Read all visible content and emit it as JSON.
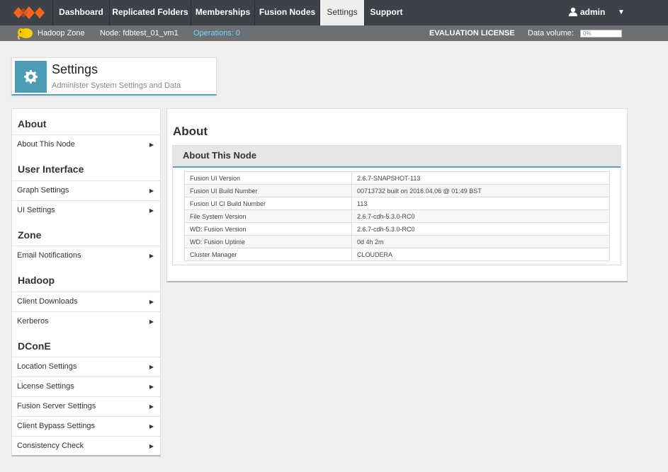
{
  "nav": {
    "tabs": [
      {
        "label": "Dashboard",
        "active": false
      },
      {
        "label": "Replicated Folders",
        "active": false
      },
      {
        "label": "Memberships",
        "active": false
      },
      {
        "label": "Fusion Nodes",
        "active": false
      },
      {
        "label": "Settings",
        "active": true
      },
      {
        "label": "Support",
        "active": false
      }
    ],
    "user": "admin",
    "user_caret": "▼"
  },
  "status": {
    "zone": "Hadoop Zone",
    "node": "Node: fdbtest_01_vm1",
    "operations": "Operations: 0",
    "license": "EVALUATION LICENSE",
    "data_volume_label": "Data volume:",
    "data_volume_value": "0%"
  },
  "header": {
    "title": "Settings",
    "subtitle": "Administer System Settings and Data"
  },
  "sidebar": {
    "sections": [
      {
        "heading": "About",
        "items": [
          "About This Node"
        ]
      },
      {
        "heading": "User Interface",
        "items": [
          "Graph Settings",
          "UI Settings"
        ]
      },
      {
        "heading": "Zone",
        "items": [
          "Email Notifications"
        ]
      },
      {
        "heading": "Hadoop",
        "items": [
          "Client Downloads",
          "Kerberos"
        ]
      },
      {
        "heading": "DConE",
        "items": [
          "Location Settings",
          "License Settings",
          "Fusion Server Settings",
          "Client Bypass Settings",
          "Consistency Check"
        ]
      }
    ],
    "arrow": "▶"
  },
  "main": {
    "title": "About",
    "panel_title": "About This Node",
    "rows": [
      {
        "key": "Fusion UI Version",
        "value": "2.6.7-SNAPSHOT-113"
      },
      {
        "key": "Fusion UI Build Number",
        "value": "00713732 built on 2016.04.06 @ 01:49 BST"
      },
      {
        "key": "Fusion UI CI Build Number",
        "value": "113"
      },
      {
        "key": "File System Version",
        "value": "2.6.7-cdh-5.3.0-RC0"
      },
      {
        "key": "WD: Fusion Version",
        "value": "2.6.7-cdh-5.3.0-RC0"
      },
      {
        "key": "WD: Fusion Uptime",
        "value": "0d 4h 2m"
      },
      {
        "key": "Cluster Manager",
        "value": "CLOUDERA"
      }
    ]
  },
  "colors": {
    "nav_bg": "#3d4249",
    "status_bg": "#6b7075",
    "accent": "#5aa1b6",
    "logo": "#f26522",
    "operations": "#7fd3f7"
  },
  "icons": {
    "logo": "wandisco-logo-icon",
    "user": "user-icon",
    "zone": "hadoop-elephant-icon",
    "settings": "gear-icon",
    "arrow": "chevron-right-icon"
  }
}
